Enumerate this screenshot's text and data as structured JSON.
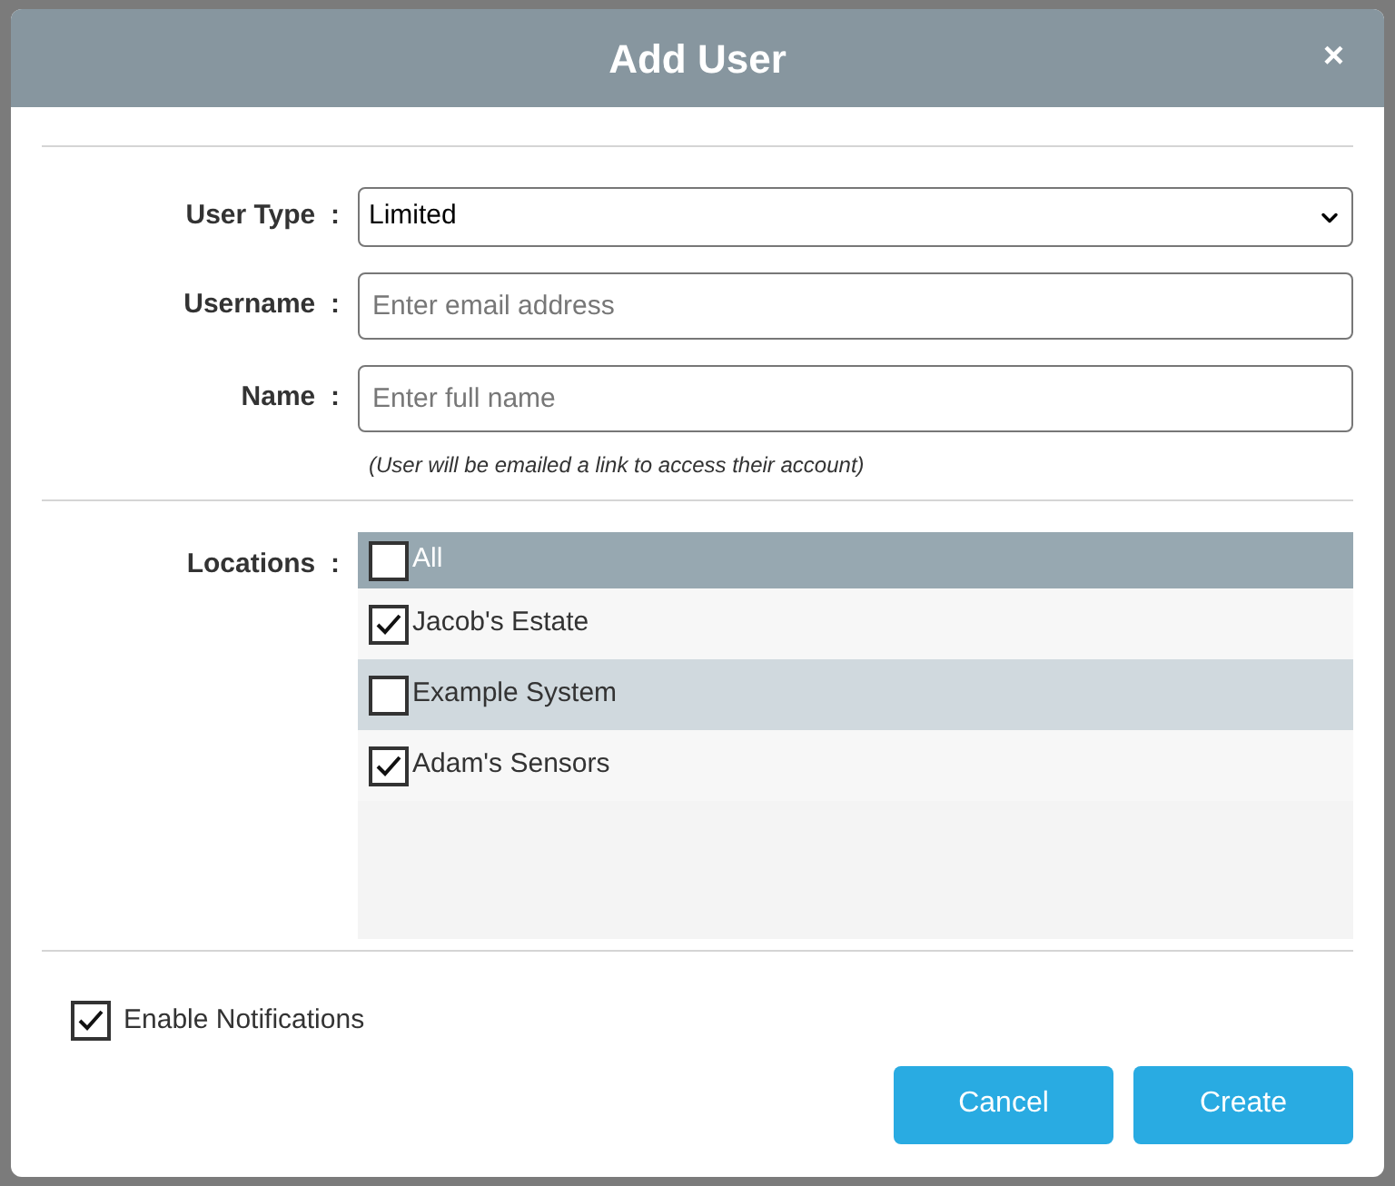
{
  "dialog": {
    "title": "Add User",
    "close": "×"
  },
  "fields": [
    {
      "label": "User Type",
      "separator": ":",
      "kind": "select",
      "value": "Limited"
    },
    {
      "label": "Username",
      "separator": ":",
      "kind": "text",
      "placeholder": "Enter email address"
    },
    {
      "label": "Name",
      "separator": ":",
      "kind": "text",
      "placeholder": "Enter full name"
    }
  ],
  "hint": "(User will be emailed a link to access their account)",
  "locations": {
    "label": "Locations",
    "separator": ":",
    "all": {
      "label": "All",
      "checked": false
    },
    "items": [
      {
        "label": "Jacob's Estate",
        "checked": true
      },
      {
        "label": "Example System",
        "checked": false
      },
      {
        "label": "Adam's Sensors",
        "checked": true
      }
    ]
  },
  "notifications": {
    "label": "Enable Notifications",
    "checked": true
  },
  "buttons": [
    "Cancel",
    "Create"
  ]
}
